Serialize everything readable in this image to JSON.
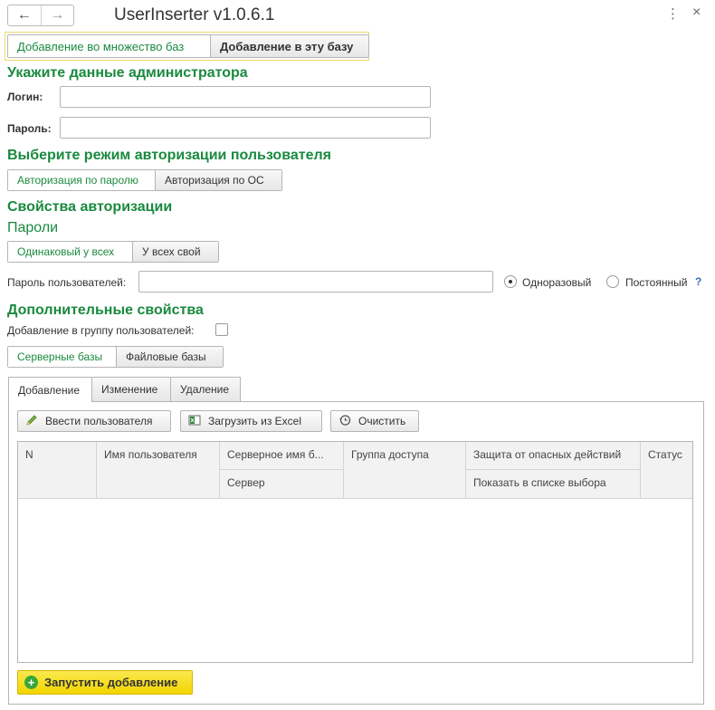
{
  "window": {
    "title": "UserInserter v1.0.6.1",
    "back_icon": "←",
    "forward_icon": "→",
    "more_icon": "⋮",
    "close_icon": "×"
  },
  "mode_switch": {
    "options": [
      "Добавление во множество баз",
      "Добавление в эту базу"
    ],
    "selected": "Добавление во множество баз"
  },
  "admin": {
    "heading": "Укажите данные администратора",
    "login_label": "Логин:",
    "login_value": "",
    "password_label": "Пароль:",
    "password_value": ""
  },
  "auth_mode": {
    "heading": "Выберите режим авторизации пользователя",
    "options": [
      "Авторизация по паролю",
      "Авторизация по ОС"
    ],
    "selected": "Авторизация по паролю"
  },
  "auth_props": {
    "heading": "Свойства авторизации",
    "passwords_heading": "Пароли",
    "password_options": [
      "Одинаковый у всех",
      "У всех свой"
    ],
    "selected": "Одинаковый у всех",
    "user_password_label": "Пароль пользователей:",
    "user_password_value": "",
    "radio_onetime": "Одноразовый",
    "radio_permanent": "Постоянный",
    "radio_selected": "Одноразовый",
    "help": "?"
  },
  "extra": {
    "heading": "Дополнительные свойства",
    "group_label": "Добавление в группу пользователей:",
    "group_checked": false,
    "base_options": [
      "Серверные базы",
      "Файловые базы"
    ],
    "base_selected": "Серверные базы"
  },
  "tabs": [
    {
      "label": "Добавление",
      "active": true
    },
    {
      "label": "Изменение",
      "active": false
    },
    {
      "label": "Удаление",
      "active": false
    }
  ],
  "toolbar": {
    "enter_users": "Ввести пользователя",
    "load_excel": "Загрузить из Excel",
    "clear": "Очистить"
  },
  "table": {
    "columns": {
      "n": "N",
      "user_name": "Имя пользователя",
      "server_db_name": "Серверное имя б...",
      "server": "Сервер",
      "access_group": "Группа доступа",
      "protection": "Защита от опасных действий",
      "show_in_list": "Показать в списке выбора",
      "status": "Статус"
    },
    "rows": []
  },
  "run_button": "Запустить добавление",
  "colors": {
    "accent_green": "#1a8a3e",
    "run_yellow": "#f2d500",
    "focus_frame": "#f0d96a"
  }
}
